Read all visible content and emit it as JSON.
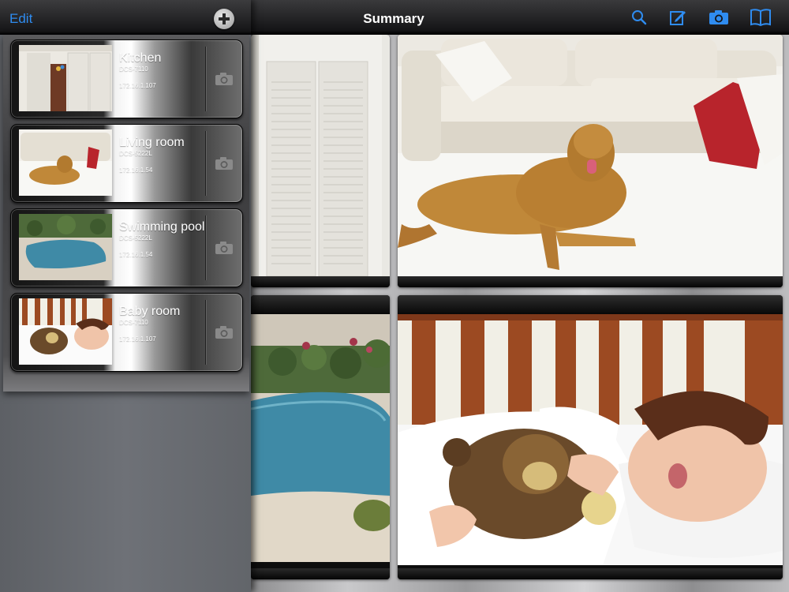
{
  "sidebar": {
    "edit_label": "Edit",
    "add_icon": "plus-circle-icon",
    "cameras": [
      {
        "name": "Kitchen",
        "model": "DCS-7110",
        "ip": "172.16.1.107"
      },
      {
        "name": "Living room",
        "model": "DCS-5222L",
        "ip": "172.16.1.54"
      },
      {
        "name": "Swimming pool",
        "model": "DCS-5222L",
        "ip": "172.16.1.54"
      },
      {
        "name": "Baby room",
        "model": "DCS-7110",
        "ip": "172.16.1.107"
      }
    ]
  },
  "toolbar": {
    "title": "Summary",
    "icons": [
      "search-icon",
      "edit-icon",
      "camera-icon",
      "book-icon"
    ],
    "accent": "#2f8cf0"
  }
}
